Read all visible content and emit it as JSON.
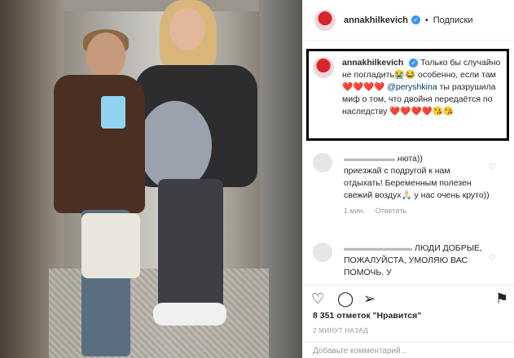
{
  "header": {
    "username": "annakhilkevich",
    "separator": "•",
    "follow_label": "Подписки"
  },
  "caption": {
    "username": "annakhilkevich",
    "line1": "Только бы случайно не погладить😭😂 особенно, если там ❤️❤️❤️❤️",
    "mention": "@peryshkina",
    "line2": "ты разрушила миф о том, что двойня передаётся по наследству ❤️❤️❤️❤️😘😘"
  },
  "comments": [
    {
      "text_user": "нюта))",
      "text": "приезжай с подругой к нам отдыхать! Беременным полезен свежий воздух🙏🏻 у нас очень круто))",
      "time": "1 мин.",
      "reply": "Ответить"
    },
    {
      "text": "ЛЮДИ ДОБРЫЕ, ПОЖАЛУЙСТА, УМОЛЯЮ ВАС ПОМОЧЬ. У"
    }
  ],
  "actions": {
    "heart_icon": "♡",
    "comment_icon": "◯",
    "share_icon": "➢",
    "save_icon": "⚑"
  },
  "likes_text": "8 351 отметок \"Нравится\"",
  "time_text": "2 МИНУТ НАЗАД",
  "add_comment_placeholder": "Добавьте комментарий..."
}
